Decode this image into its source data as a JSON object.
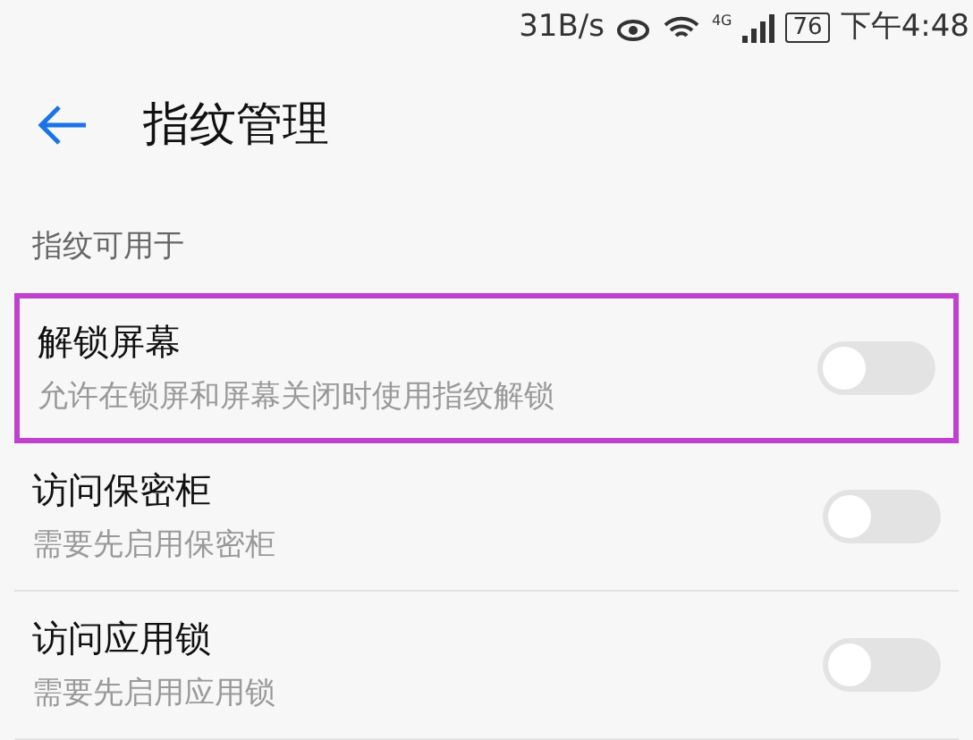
{
  "status_bar": {
    "speed": "31B/s",
    "network": "4G",
    "battery": "76",
    "time": "下午4:48"
  },
  "header": {
    "title": "指纹管理"
  },
  "section": {
    "title": "指纹可用于"
  },
  "items": [
    {
      "title": "解锁屏幕",
      "subtitle": "允许在锁屏和屏幕关闭时使用指纹解锁",
      "on": false,
      "highlighted": true
    },
    {
      "title": "访问保密柜",
      "subtitle": "需要先启用保密柜",
      "on": false,
      "highlighted": false
    },
    {
      "title": "访问应用锁",
      "subtitle": "需要先启用应用锁",
      "on": false,
      "highlighted": false
    }
  ]
}
